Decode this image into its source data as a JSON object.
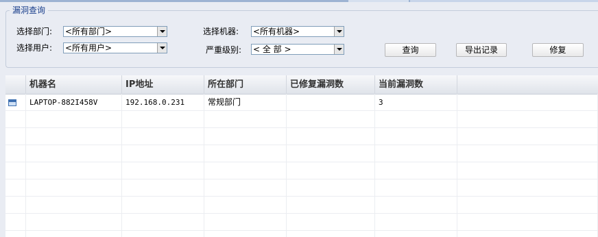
{
  "form": {
    "legend": "漏洞查询",
    "dept_label": "选择部门:",
    "dept_value": "<所有部门>",
    "user_label": "选择用户:",
    "user_value": "<所有用户>",
    "machine_label": "选择机器:",
    "machine_value": "<所有机器>",
    "severity_label": "严重级别:",
    "severity_value": "< 全 部 >"
  },
  "buttons": {
    "query": "查询",
    "export": "导出记录",
    "repair": "修复"
  },
  "table": {
    "columns": [
      "机器名",
      "IP地址",
      "所在部门",
      "已修复漏洞数",
      "当前漏洞数"
    ],
    "rows": [
      {
        "machine": "LAPTOP-882I458V",
        "ip": "192.168.0.231",
        "dept": "常规部门",
        "fixed": "",
        "current": "3",
        "icon": "computer-icon"
      }
    ]
  },
  "colors": {
    "legend": "#1a3f8c",
    "panel_bg": "#e9ecf3",
    "header_text": "#333333"
  }
}
